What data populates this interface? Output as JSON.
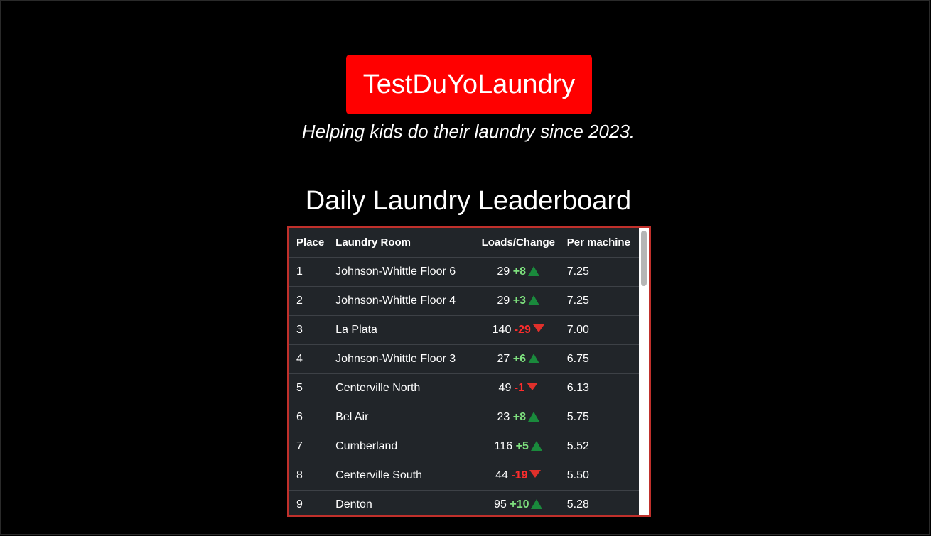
{
  "header": {
    "brand": "TestDuYoLaundry",
    "tagline": "Helping kids do their laundry since 2023."
  },
  "leaderboard": {
    "title": "Daily Laundry Leaderboard",
    "columns": [
      "Place",
      "Laundry Room",
      "Loads/Change",
      "Per machine"
    ],
    "rows": [
      {
        "place": "1",
        "room": "Johnson-Whittle Floor 6",
        "loads": "29",
        "change": "+8",
        "direction": "up",
        "per_machine": "7.25"
      },
      {
        "place": "2",
        "room": "Johnson-Whittle Floor 4",
        "loads": "29",
        "change": "+3",
        "direction": "up",
        "per_machine": "7.25"
      },
      {
        "place": "3",
        "room": "La Plata",
        "loads": "140",
        "change": "-29",
        "direction": "down",
        "per_machine": "7.00"
      },
      {
        "place": "4",
        "room": "Johnson-Whittle Floor 3",
        "loads": "27",
        "change": "+6",
        "direction": "up",
        "per_machine": "6.75"
      },
      {
        "place": "5",
        "room": "Centerville North",
        "loads": "49",
        "change": "-1",
        "direction": "down",
        "per_machine": "6.13"
      },
      {
        "place": "6",
        "room": "Bel Air",
        "loads": "23",
        "change": "+8",
        "direction": "up",
        "per_machine": "5.75"
      },
      {
        "place": "7",
        "room": "Cumberland",
        "loads": "116",
        "change": "+5",
        "direction": "up",
        "per_machine": "5.52"
      },
      {
        "place": "8",
        "room": "Centerville South",
        "loads": "44",
        "change": "-19",
        "direction": "down",
        "per_machine": "5.50"
      },
      {
        "place": "9",
        "room": "Denton",
        "loads": "95",
        "change": "+10",
        "direction": "up",
        "per_machine": "5.28"
      }
    ]
  },
  "colors": {
    "brand_bg": "#ff0000",
    "table_bg": "#212529",
    "table_border": "#c0302b",
    "delta_up": "#7ee07e",
    "delta_down": "#ff2d2d",
    "arrow_up": "#1a8a3c",
    "arrow_down": "#e0302b"
  },
  "icons": {
    "up": "triangle-up-icon",
    "down": "triangle-down-icon"
  }
}
